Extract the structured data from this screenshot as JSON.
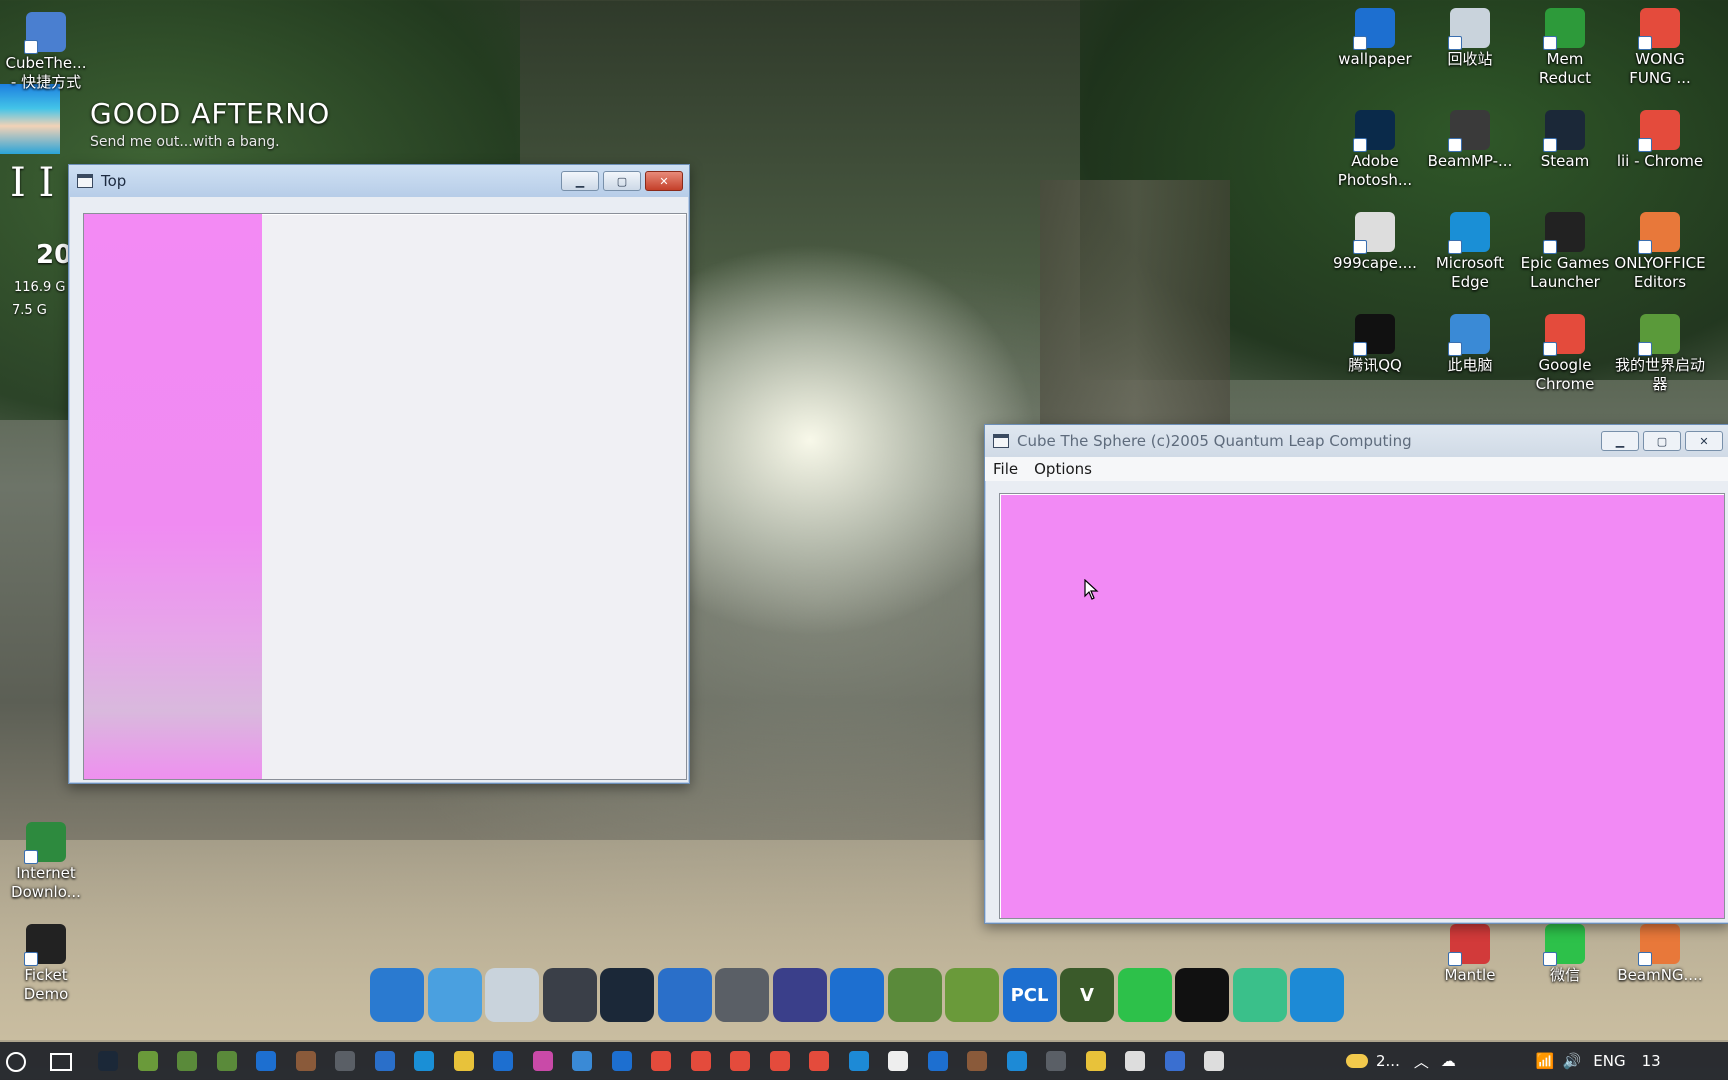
{
  "desktop": {
    "icons_left": [
      {
        "label": "CubeThe...\n- 快捷方式",
        "icon": "cube-shortcut-icon",
        "color": "#4a7fd0"
      },
      {
        "label": "Internet\nDownlo...",
        "icon": "internet-download-manager-icon",
        "color": "#2d8a3e"
      },
      {
        "label": "Ficket Demo",
        "icon": "ficket-demo-icon",
        "color": "#222222"
      }
    ],
    "icons_right": [
      {
        "label": "wallpaper",
        "icon": "wallpaper-icon",
        "color": "#1d6fd0"
      },
      {
        "label": "回收站",
        "icon": "recycle-bin-icon",
        "color": "#c9d3dc"
      },
      {
        "label": "Mem\nReduct",
        "icon": "mem-reduct-icon",
        "color": "#2d9a3a"
      },
      {
        "label": "WONG\nFUNG ...",
        "icon": "chrome-icon",
        "color": "#e44b3c"
      },
      {
        "label": "Adobe\nPhotosh...",
        "icon": "photoshop-icon",
        "color": "#0a2a4a"
      },
      {
        "label": "BeamMP-...",
        "icon": "beammp-icon",
        "color": "#3a3a3a"
      },
      {
        "label": "Steam",
        "icon": "steam-icon",
        "color": "#1b2838"
      },
      {
        "label": "lii - Chrome",
        "icon": "chrome-icon",
        "color": "#e44b3c"
      },
      {
        "label": "999cape....",
        "icon": "cape-icon",
        "color": "#dddddd"
      },
      {
        "label": "Microsoft\nEdge",
        "icon": "edge-icon",
        "color": "#1a8fd6"
      },
      {
        "label": "Epic Games\nLauncher",
        "icon": "epic-games-icon",
        "color": "#222222"
      },
      {
        "label": "ONLYOFFICE\nEditors",
        "icon": "onlyoffice-icon",
        "color": "#e8783a"
      },
      {
        "label": "腾讯QQ",
        "icon": "qq-icon",
        "color": "#111111"
      },
      {
        "label": "此电脑",
        "icon": "this-pc-icon",
        "color": "#3a8ad6"
      },
      {
        "label": "Google\nChrome",
        "icon": "chrome-icon",
        "color": "#e44b3c"
      },
      {
        "label": "我的世界启动\n器",
        "icon": "minecraft-launcher-icon",
        "color": "#5a9a3a"
      },
      {
        "label": "Mantle",
        "icon": "mantle-icon",
        "color": "#d23a3a"
      },
      {
        "label": "微信",
        "icon": "wechat-icon",
        "color": "#2dc14a"
      },
      {
        "label": "BeamNG....",
        "icon": "beamng-icon",
        "color": "#e8783a"
      }
    ]
  },
  "widget": {
    "greeting": "GOOD AFTERNO",
    "subtitle": "Send me out...with a bang.",
    "time_fragment": "20",
    "stat1": "116.9 G",
    "stat2": "7.5 G"
  },
  "window_top": {
    "title": "Top",
    "minimize": "▁",
    "maximize": "▢",
    "close": "✕",
    "pink": "#f08bf2"
  },
  "window_cube": {
    "title": "Cube The Sphere (c)2005 Quantum Leap Computing",
    "menu": [
      "File",
      "Options"
    ],
    "minimize": "▁",
    "maximize": "▢",
    "close": "✕",
    "canvas_color": "#f28af5"
  },
  "dock": {
    "items": [
      {
        "name": "this-pc-dock-icon",
        "color": "#2a7ad0",
        "glyph": ""
      },
      {
        "name": "control-panel-dock-icon",
        "color": "#4aa0e0",
        "glyph": ""
      },
      {
        "name": "recycle-bin-dock-icon",
        "color": "#c9d3dc",
        "glyph": ""
      },
      {
        "name": "windows-dock-icon",
        "color": "#3a3f48",
        "glyph": ""
      },
      {
        "name": "steam-dock-icon",
        "color": "#1b2838",
        "glyph": ""
      },
      {
        "name": "lion-dock-icon",
        "color": "#2a6fc9",
        "glyph": ""
      },
      {
        "name": "moon-dock-icon",
        "color": "#5a5f66",
        "glyph": ""
      },
      {
        "name": "character-dock-icon",
        "color": "#3a3f8a",
        "glyph": ""
      },
      {
        "name": "camera-dock-icon",
        "color": "#1d6fd0",
        "glyph": ""
      },
      {
        "name": "grass-block-dock-icon",
        "color": "#5a8a3a",
        "glyph": ""
      },
      {
        "name": "minecraft-dock-icon",
        "color": "#6a9a3a",
        "glyph": ""
      },
      {
        "name": "pcl-dock-icon",
        "color": "#1d6fd0",
        "glyph": "PCL"
      },
      {
        "name": "gta-v-dock-icon",
        "color": "#3a5a2a",
        "glyph": "V"
      },
      {
        "name": "wechat-dock-icon",
        "color": "#2dc14a",
        "glyph": ""
      },
      {
        "name": "qq-dock-icon",
        "color": "#111111",
        "glyph": ""
      },
      {
        "name": "music-dock-icon",
        "color": "#3ac08a",
        "glyph": ""
      },
      {
        "name": "search-dock-icon",
        "color": "#1d8ad6",
        "glyph": ""
      }
    ]
  },
  "taskbar": {
    "weather": "2...",
    "language": "ENG",
    "clock": "13"
  }
}
